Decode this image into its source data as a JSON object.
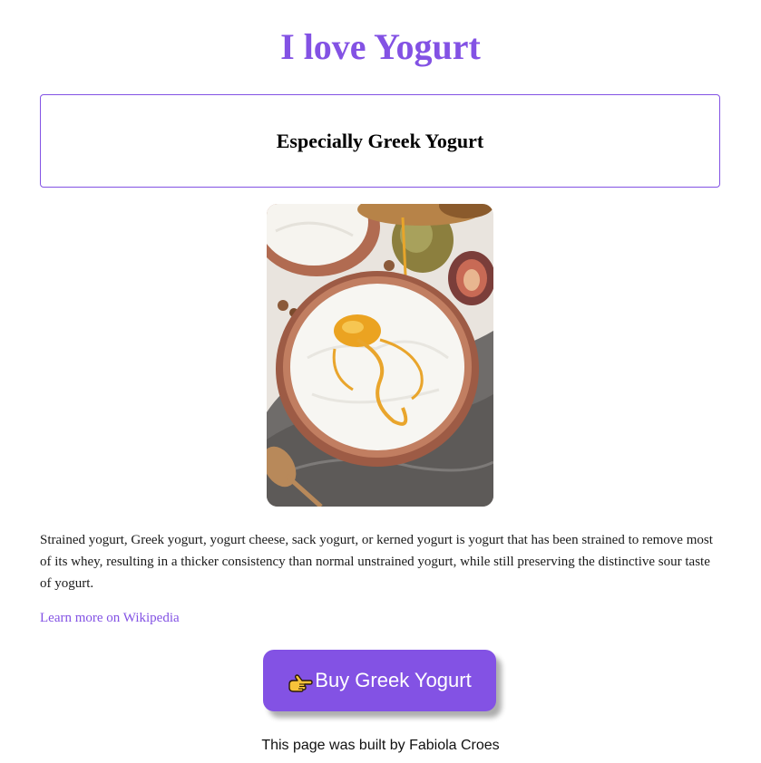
{
  "header": {
    "title": "I love Yogurt",
    "subtitle": "Especially Greek Yogurt"
  },
  "hero_image": {
    "alt": "greek-yogurt-bowl",
    "icon": "yogurt-bowl-photo"
  },
  "content": {
    "description": "Strained yogurt, Greek yogurt, yogurt cheese, sack yogurt, or kerned yogurt is yogurt that has been strained to remove most of its whey, resulting in a thicker consistency than normal unstrained yogurt, while still preserving the distinctive sour taste of yogurt.",
    "link_text": "Learn more on Wikipedia"
  },
  "cta": {
    "icon": "pointing-hand-icon",
    "label": "Buy Greek Yogurt"
  },
  "footer": {
    "text": "This page was built by Fabiola Croes"
  },
  "colors": {
    "accent": "#8352e4",
    "text": "#1a1a1a",
    "background": "#ffffff"
  }
}
